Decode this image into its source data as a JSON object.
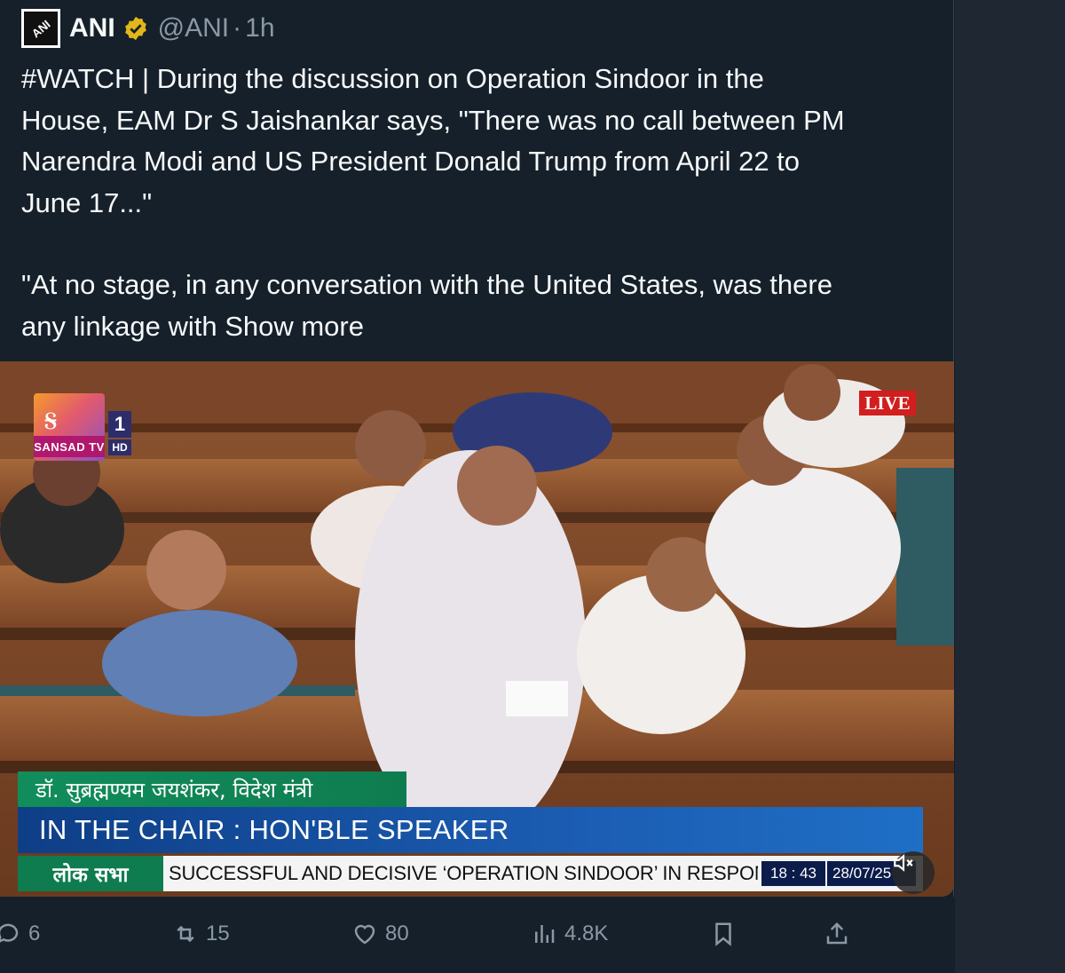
{
  "tweet": {
    "display_name": "ANI",
    "avatar_text": "ANI",
    "handle": "@ANI",
    "separator": "·",
    "time": "1h",
    "text_line1": "#WATCH | During the discussion on Operation Sindoor in the",
    "text_line2": "House, EAM Dr S Jaishankar says, \"There was no call between PM",
    "text_line3": "Narendra Modi and US President Donald Trump from April 22 to",
    "text_line4": "June 17...\"",
    "text_line5": "\"At no stage, in any conversation with the United States, was there",
    "text_line6_prefix": "any linkage with",
    "show_more": "Show more"
  },
  "video": {
    "channel_label": "SANSAD TV",
    "channel_number": "1",
    "channel_hd": "HD",
    "live_badge": "LIVE",
    "speaker_name": "डॉ. सुब्रह्मण्यम जयशंकर, विदेश मंत्री",
    "chair_text": "IN THE CHAIR : HON'BLE SPEAKER",
    "house_label": "लोक सभा",
    "ticker_text": "SUCCESSFUL AND DECISIVE ‘OPERATION SINDOOR’ IN RESPONSE",
    "clock": "18 : 43",
    "date": "28/07/25"
  },
  "actions": {
    "replies": "6",
    "reposts": "15",
    "likes": "80",
    "views": "4.8K"
  },
  "colors": {
    "background": "#15202b",
    "verified_badge": "#e2b719",
    "muted_text": "#8b98a5",
    "live_red": "#d21e1e",
    "name_bar_green": "#118d5b",
    "chair_bar_blue": "#1b5cb1"
  }
}
